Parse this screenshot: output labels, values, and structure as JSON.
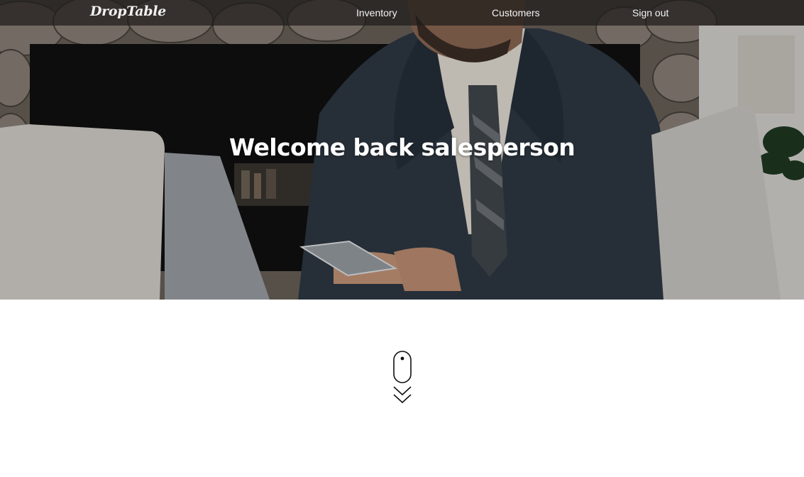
{
  "nav": {
    "brand": "DropTable",
    "links": [
      {
        "label": "Inventory"
      },
      {
        "label": "Customers"
      },
      {
        "label": "Sign out"
      }
    ]
  },
  "hero": {
    "title": "Welcome back salesperson"
  },
  "icons": {
    "scroll": "mouse-scroll-down-icon"
  }
}
